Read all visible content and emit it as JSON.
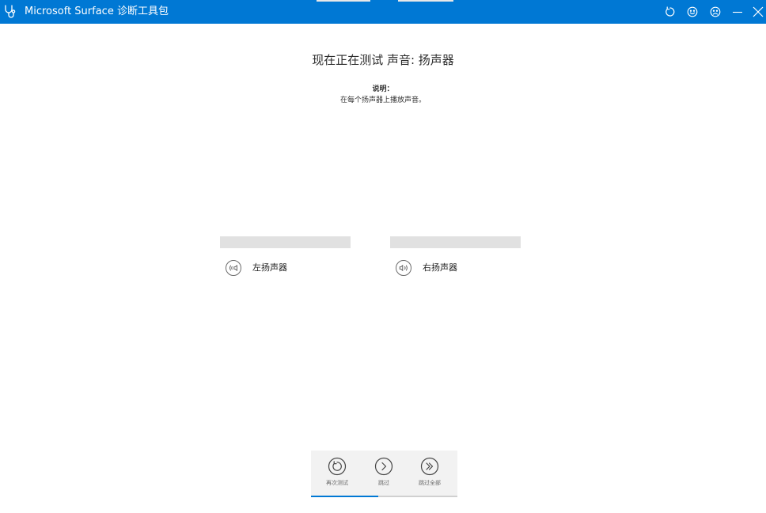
{
  "titlebar": {
    "title": "Microsoft Surface 诊断工具包",
    "icon": "stethoscope-icon",
    "controls": [
      {
        "name": "refresh-icon"
      },
      {
        "name": "smile-icon"
      },
      {
        "name": "frown-icon"
      },
      {
        "name": "minimize-icon"
      },
      {
        "name": "close-icon"
      }
    ]
  },
  "main": {
    "heading": "现在正在测试 声音: 扬声器",
    "instructions_label": "说明：",
    "instructions_text": "在每个扬声器上播放声音。"
  },
  "speakers": [
    {
      "label": "左扬声器",
      "icon": "left-speaker-icon"
    },
    {
      "label": "右扬声器",
      "icon": "right-speaker-icon"
    }
  ],
  "actions": [
    {
      "label": "再次测试",
      "icon": "retry-icon"
    },
    {
      "label": "跳过",
      "icon": "skip-icon"
    },
    {
      "label": "跳过全部",
      "icon": "skip-all-icon"
    }
  ],
  "progress": {
    "fraction": 0.46
  },
  "colors": {
    "accent": "#0078d4",
    "bar": "#e1e1e1",
    "action_bg": "#f2f2f2"
  }
}
